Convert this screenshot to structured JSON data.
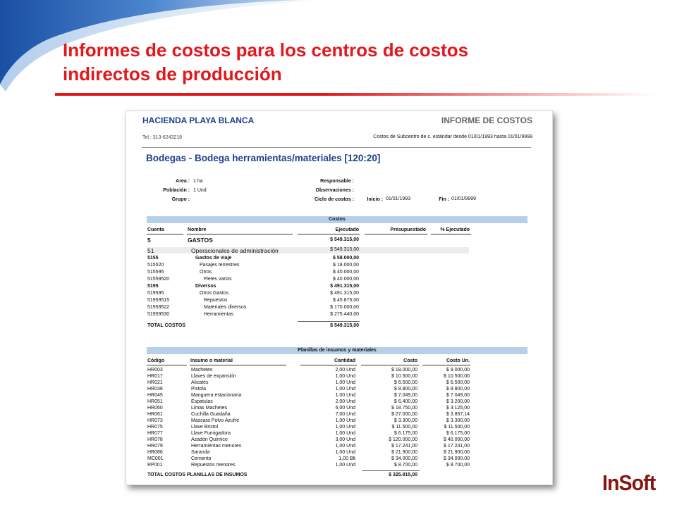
{
  "slide": {
    "title_line1": "Informes de costos para los centros de costos",
    "title_line2": "indirectos de producción",
    "logo_in": "In",
    "logo_soft": "Soft",
    "colors": {
      "title": "#e3171c",
      "accent_blue": "#1f3f8f",
      "band": "#b7d0ea"
    }
  },
  "report": {
    "company": "HACIENDA PLAYA BLANCA",
    "doc_type": "INFORME DE COSTOS",
    "phone": "Tel.: 313-6243218",
    "range": "Costos de Subcentro de c. estándar desde 01/01/1993 hasta 01/01/9999",
    "center": "Bodegas - Bodega herramientas/materiales [120:20]",
    "info": {
      "area_label": "Area :",
      "area_value": "1 ha",
      "poblacion_label": "Población :",
      "poblacion_value": "1 Und",
      "grupo_label": "Grupo :",
      "responsable_label": "Responsable :",
      "observaciones_label": "Observaciones :",
      "ciclo_label": "Ciclo de costos :",
      "inicio_label": "Inicio :",
      "inicio_value": "01/01/1993",
      "fin_label": "Fin :",
      "fin_value": "01/01/9999"
    },
    "costos": {
      "band": "Costos",
      "headers": {
        "cuenta": "Cuenta",
        "nombre": "Nombre",
        "ejecutado": "Ejecutado",
        "presupuestado": "Presupuestado",
        "pct": "% Ejecutado"
      },
      "gastos": {
        "cuenta": "5",
        "nombre": "GASTOS",
        "ejecutado": "$ 549.315,00"
      },
      "grupo": {
        "cuenta": "51",
        "nombre": "Operacionales de administración",
        "ejecutado": "$ 549.315,00"
      },
      "rows": [
        {
          "cuenta": "5155",
          "nombre": "Gastos de viaje",
          "ejecutado": "$ 58.000,00",
          "level": 1,
          "bold": true
        },
        {
          "cuenta": "515520",
          "nombre": "Pasajes terrestres",
          "ejecutado": "$ 18.000,00",
          "level": 2,
          "bold": false
        },
        {
          "cuenta": "515595",
          "nombre": "Otros",
          "ejecutado": "$ 40.000,00",
          "level": 2,
          "bold": false
        },
        {
          "cuenta": "51559520",
          "nombre": "Fletes varios",
          "ejecutado": "$ 40.000,00",
          "level": 3,
          "bold": false
        },
        {
          "cuenta": "5195",
          "nombre": "Diversos",
          "ejecutado": "$ 491.315,00",
          "level": 1,
          "bold": true
        },
        {
          "cuenta": "519595",
          "nombre": "Otros Gastos",
          "ejecutado": "$ 491.315,00",
          "level": 2,
          "bold": false
        },
        {
          "cuenta": "51959515",
          "nombre": "Repuestos",
          "ejecutado": "$ 45.875,00",
          "level": 3,
          "bold": false
        },
        {
          "cuenta": "51959522",
          "nombre": "Materiales diversos",
          "ejecutado": "$ 170.000,00",
          "level": 3,
          "bold": false
        },
        {
          "cuenta": "51959530",
          "nombre": "Herramientas",
          "ejecutado": "$ 275.440,00",
          "level": 3,
          "bold": false
        }
      ],
      "total_label": "TOTAL COSTOS",
      "total_value": "$ 549.315,00"
    },
    "planillas": {
      "band": "Planillas de insumos y materiales",
      "headers": {
        "codigo": "Código",
        "insumo": "Insumo o material",
        "cantidad": "Cantidad",
        "costo": "Costo",
        "costo_un": "Costo Un."
      },
      "rows": [
        {
          "codigo": "HR003",
          "insumo": "Machetes",
          "cantidad": "2,00 Und",
          "costo": "$ 18.000,00",
          "costo_un": "$ 9.000,00"
        },
        {
          "codigo": "HR017",
          "insumo": "Llaves de expansión",
          "cantidad": "1,00 Und",
          "costo": "$ 10.500,00",
          "costo_un": "$ 10.500,00"
        },
        {
          "codigo": "HR021",
          "insumo": "Alicates",
          "cantidad": "1,00 Und",
          "costo": "$ 6.500,00",
          "costo_un": "$ 6.500,00"
        },
        {
          "codigo": "HR038",
          "insumo": "Pistola",
          "cantidad": "1,00 Und",
          "costo": "$ 8.800,00",
          "costo_un": "$ 8.800,00"
        },
        {
          "codigo": "HR045",
          "insumo": "Manguera estacionaria",
          "cantidad": "1,00 Und",
          "costo": "$ 7.049,00",
          "costo_un": "$ 7.049,00"
        },
        {
          "codigo": "HR051",
          "insumo": "Espatulas",
          "cantidad": "2,00 Und",
          "costo": "$ 6.400,00",
          "costo_un": "$ 3.200,00"
        },
        {
          "codigo": "HR060",
          "insumo": "Limas Machetes",
          "cantidad": "6,00 Und",
          "costo": "$ 18.750,00",
          "costo_un": "$ 3.125,00"
        },
        {
          "codigo": "HR061",
          "insumo": "Cuchilla Guadaña",
          "cantidad": "7,00 Und",
          "costo": "$ 27.000,00",
          "costo_un": "$ 3.857,14"
        },
        {
          "codigo": "HR073",
          "insumo": "Mascara Polvo Azufre",
          "cantidad": "1,00 Und",
          "costo": "$ 3.300,00",
          "costo_un": "$ 3.300,00"
        },
        {
          "codigo": "HR075",
          "insumo": "Llave Bristol",
          "cantidad": "1,00 Und",
          "costo": "$ 11.500,00",
          "costo_un": "$ 11.500,00"
        },
        {
          "codigo": "HR077",
          "insumo": "Llave Fumigadora",
          "cantidad": "1,00 Und",
          "costo": "$ 6.175,00",
          "costo_un": "$ 6.175,00"
        },
        {
          "codigo": "HR078",
          "insumo": "Azadón Químico",
          "cantidad": "3,00 Und",
          "costo": "$ 120.000,00",
          "costo_un": "$ 40.000,00"
        },
        {
          "codigo": "HR079",
          "insumo": "Herramientas menores",
          "cantidad": "1,00 Und",
          "costo": "$ 17.241,00",
          "costo_un": "$ 17.241,00"
        },
        {
          "codigo": "HR086",
          "insumo": "Saranda",
          "cantidad": "1,00 Und",
          "costo": "$ 21.900,00",
          "costo_un": "$ 21.900,00"
        },
        {
          "codigo": "MC001",
          "insumo": "Cemento",
          "cantidad": "1,00 Blt",
          "costo": "$ 34.000,00",
          "costo_un": "$ 34.000,00"
        },
        {
          "codigo": "RP001",
          "insumo": "Repuestos menores",
          "cantidad": "1,00 Und",
          "costo": "$ 8.700,00",
          "costo_un": "$ 8.700,00"
        }
      ],
      "total_label": "TOTAL COSTOS PLANILLAS DE INSUMOS",
      "total_value": "$ 325.815,00"
    }
  }
}
